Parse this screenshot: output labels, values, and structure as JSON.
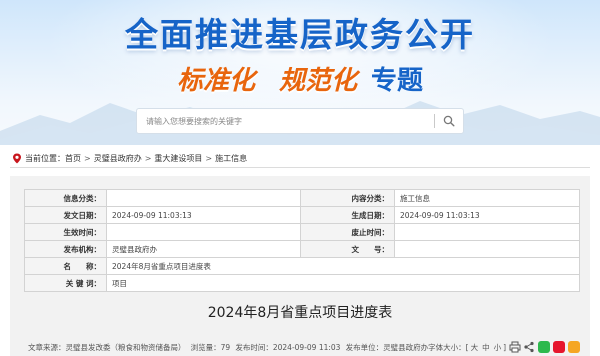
{
  "banner": {
    "title": "全面推进基层政务公开",
    "subtitle_1": "标准化",
    "subtitle_2": "规范化",
    "subtitle_3": "专题"
  },
  "search": {
    "placeholder": "请输入您想要搜索的关键字",
    "icon": "search-icon"
  },
  "breadcrumb": {
    "prefix": "当前位置：",
    "items": [
      "首页",
      "灵璧县政府办",
      "重大建设项目",
      "施工信息"
    ],
    "separator": ">"
  },
  "info": {
    "rows": [
      {
        "k1": "信息分类：",
        "v1": "",
        "k2": "内容分类：",
        "v2": "施工信息"
      },
      {
        "k1": "发文日期：",
        "v1": "2024-09-09 11:03:13",
        "k2": "生成日期：",
        "v2": "2024-09-09 11:03:13"
      },
      {
        "k1": "生效时间：",
        "v1": "",
        "k2": "废止时间：",
        "v2": ""
      },
      {
        "k1": "发布机构：",
        "v1": "灵璧县政府办",
        "k2": "文　　号：",
        "v2": ""
      }
    ],
    "name_label": "名　　称：",
    "name_value": "2024年8月省重点项目进度表",
    "keyword_label": "关 键 词：",
    "keyword_value": "项目"
  },
  "document": {
    "title": "2024年8月省重点项目进度表"
  },
  "meta": {
    "source": "文章来源：灵璧县发改委（粮食和物资储备局）",
    "views": "浏览量：79",
    "publish_time": "发布时间：2024-09-09 11:03",
    "publisher": "发布单位：灵璧县政府办",
    "font_label": "字体大小：",
    "font_sizes": [
      "大",
      "中",
      "小"
    ],
    "share_colors": {
      "wechat": "#2db94d",
      "weibo": "#e6162d",
      "qzone": "#f5a623"
    }
  }
}
